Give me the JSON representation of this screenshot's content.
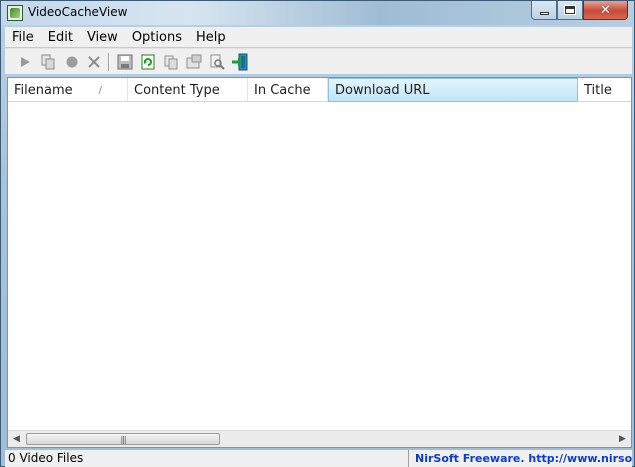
{
  "window": {
    "title": "VideoCacheView"
  },
  "menu": [
    {
      "label": "File"
    },
    {
      "label": "Edit"
    },
    {
      "label": "View"
    },
    {
      "label": "Options"
    },
    {
      "label": "Help"
    }
  ],
  "toolbar": {
    "play": "play-icon",
    "copy_files": "copy-files-icon",
    "record": "record-icon",
    "delete": "delete-icon",
    "save": "save-icon",
    "refresh": "refresh-icon",
    "copy": "copy-icon",
    "properties": "properties-icon",
    "find": "find-icon",
    "exit": "exit-icon"
  },
  "columns": [
    {
      "label": "Filename",
      "sort_mark": "/"
    },
    {
      "label": "Content Type"
    },
    {
      "label": "In Cache"
    },
    {
      "label": "Download URL"
    },
    {
      "label": "Title"
    }
  ],
  "scrollbar": {
    "grip": "|||"
  },
  "status": {
    "count": "0 Video Files",
    "credit": "NirSoft Freeware.  http://www.nirsoft.ne"
  },
  "colors": {
    "active_column": "#bfe6f6",
    "credit_link": "#0b3bd6",
    "close_button": "#c74a36"
  }
}
